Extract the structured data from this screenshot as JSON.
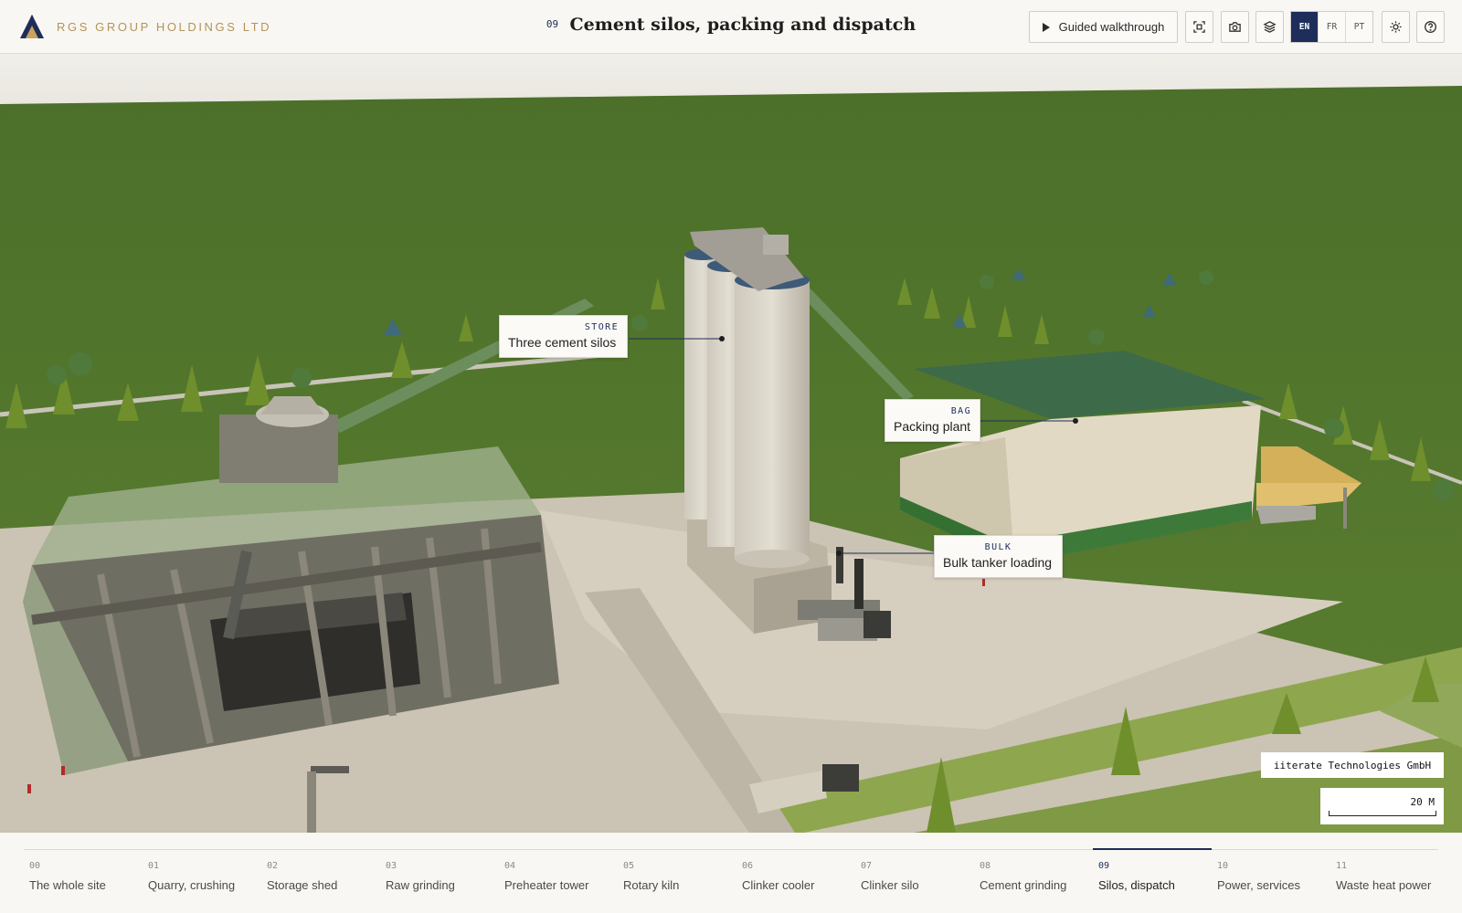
{
  "brand": {
    "name": "RGS GROUP HOLDINGS LTD",
    "logo_icon": "rgs-mountain-logo"
  },
  "header": {
    "step_number": "09",
    "title": "Cement silos, packing and dispatch",
    "walkthrough_label": "Guided walkthrough",
    "tools": [
      {
        "name": "focus-frame-icon"
      },
      {
        "name": "camera-icon"
      },
      {
        "name": "layers-icon"
      }
    ],
    "languages": [
      "EN",
      "FR",
      "PT"
    ],
    "active_language": "EN",
    "theme_icon": "sun-icon",
    "help_icon": "help-circle-icon"
  },
  "callouts": [
    {
      "tag": "STORE",
      "label": "Three cement silos"
    },
    {
      "tag": "BAG",
      "label": "Packing plant"
    },
    {
      "tag": "BULK",
      "label": "Bulk tanker loading"
    }
  ],
  "credit": "iiterate Technologies GmbH",
  "scale": {
    "label": "20 M"
  },
  "timeline": {
    "active_index": 9,
    "steps": [
      {
        "num": "00",
        "label": "The whole site"
      },
      {
        "num": "01",
        "label": "Quarry, crushing"
      },
      {
        "num": "02",
        "label": "Storage shed"
      },
      {
        "num": "03",
        "label": "Raw grinding"
      },
      {
        "num": "04",
        "label": "Preheater tower"
      },
      {
        "num": "05",
        "label": "Rotary kiln"
      },
      {
        "num": "06",
        "label": "Clinker cooler"
      },
      {
        "num": "07",
        "label": "Clinker silo"
      },
      {
        "num": "08",
        "label": "Cement grinding"
      },
      {
        "num": "09",
        "label": "Silos, dispatch"
      },
      {
        "num": "10",
        "label": "Power, services"
      },
      {
        "num": "11",
        "label": "Waste heat power"
      }
    ]
  },
  "colors": {
    "accent": "#1e2d5a",
    "brand": "#b3935a",
    "grass": "#557a2c",
    "roof": "#3d6a48"
  }
}
